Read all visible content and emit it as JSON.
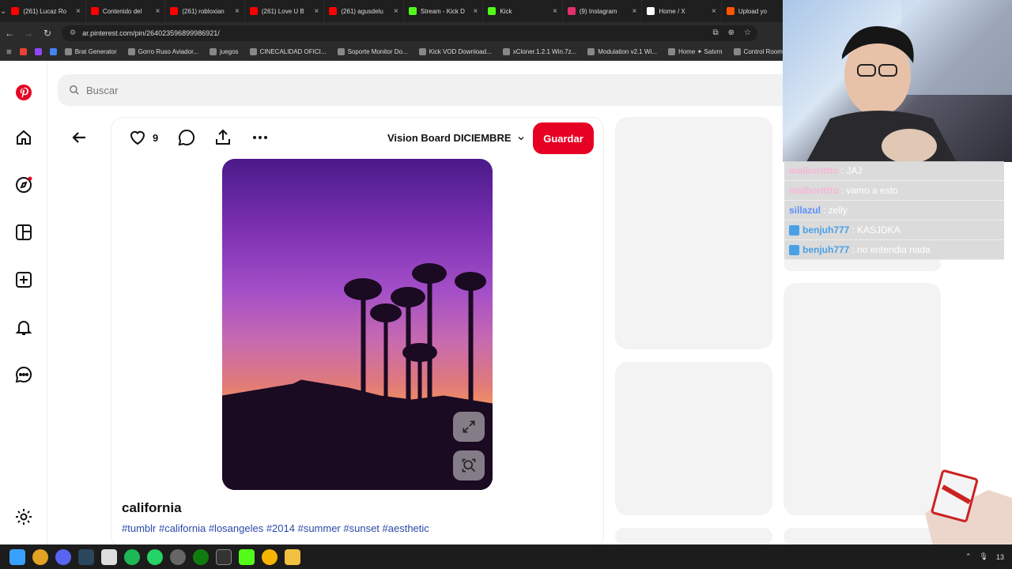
{
  "browser": {
    "tabs": [
      {
        "title": "(261) Lucaz Ro",
        "color": "#ff0000"
      },
      {
        "title": "Contenido del",
        "color": "#ff0000"
      },
      {
        "title": "(261) robloxian",
        "color": "#ff0000"
      },
      {
        "title": "(261) Love U B",
        "color": "#ff0000"
      },
      {
        "title": "(261) agusdelu",
        "color": "#ff0000"
      },
      {
        "title": "Stream - Kick D",
        "color": "#53fc18"
      },
      {
        "title": "Kick",
        "color": "#53fc18"
      },
      {
        "title": "(9) Instagram",
        "color": "#e1306c"
      },
      {
        "title": "Home / X",
        "color": "#ffffff"
      },
      {
        "title": "Upload yo",
        "color": "#ff5500"
      }
    ],
    "url": "ar.pinterest.com/pin/264023596899986921/",
    "bookmarks": [
      "Brat Generator",
      "Gorro Ruso Aviador...",
      "juegos",
      "CINECALIDAD OFICI...",
      "Soporte Monitor Do...",
      "Kick VOD Download...",
      "xCloner.1.2.1 Win.7z...",
      "Modulation v2.1 Wi...",
      "Home ✦ Satvrn",
      "Control Room"
    ]
  },
  "pinterest": {
    "search_placeholder": "Buscar",
    "like_count": "9",
    "board_name": "Vision Board DICIEMBRE",
    "save_label": "Guardar",
    "pin_title": "california",
    "pin_tags": "#tumblr #california #losangeles #2014 #summer #sunset #aesthetic",
    "brand_color": "#e60023"
  },
  "chat": {
    "messages": [
      {
        "user": "malborittto",
        "text": ": JAJ",
        "user_color": "#f7b6d8",
        "badge": false
      },
      {
        "user": "malborittto",
        "text": ": vamo a esto",
        "user_color": "#f7b6d8",
        "badge": false
      },
      {
        "user": "sillazul",
        "text": ": zelly",
        "user_color": "#5b8fff",
        "badge": false
      },
      {
        "user": "benjuh777",
        "text": ": KASJDKA",
        "user_color": "#4aa0e6",
        "badge": true
      },
      {
        "user": "benjuh777",
        "text": ": no entendia nada",
        "user_color": "#4aa0e6",
        "badge": true
      }
    ]
  },
  "taskbar": {
    "clock": "13"
  }
}
